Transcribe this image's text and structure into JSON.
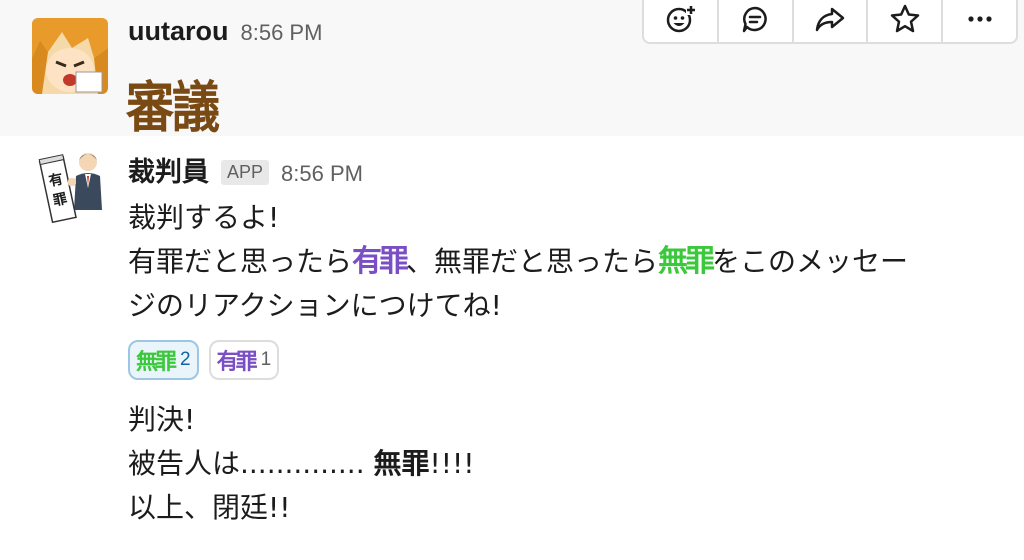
{
  "toolbar": {
    "items": [
      {
        "icon": "add-reaction-icon"
      },
      {
        "icon": "thread-reply-icon"
      },
      {
        "icon": "share-message-icon"
      },
      {
        "icon": "star-icon"
      },
      {
        "icon": "more-actions-icon"
      }
    ]
  },
  "messages": [
    {
      "sender": "uutarou",
      "time": "8:56 PM",
      "text": "審議",
      "avatar_icon": "anime-avatar"
    },
    {
      "sender": "裁判員",
      "badge": "APP",
      "time": "8:56 PM",
      "avatar_icon": "judge-bot-avatar",
      "line1": "裁判するよ!",
      "line2_a": "有罪だと思ったら",
      "emoji_guilty": "有罪",
      "line2_b": "、無罪だと思ったら",
      "emoji_innocent": "無罪",
      "line2_c": "をこのメッセー",
      "line3": "ジのリアクションにつけてね!",
      "reactions": [
        {
          "emoji": "無罪",
          "count": "2",
          "active": true,
          "color": "#3cc83c"
        },
        {
          "emoji": "有罪",
          "count": "1",
          "active": false,
          "color": "#7b4fc4"
        }
      ],
      "verdict_1": "判決!",
      "verdict_2a": "被告人は..............",
      "verdict_2b": "無罪",
      "verdict_2c": "!!!!",
      "verdict_3": "以上、閉廷!!"
    }
  ],
  "colors": {
    "accent_blue": "#1264a3",
    "hover_bg": "#f8f8f8",
    "big_text": "#7a4a14"
  }
}
